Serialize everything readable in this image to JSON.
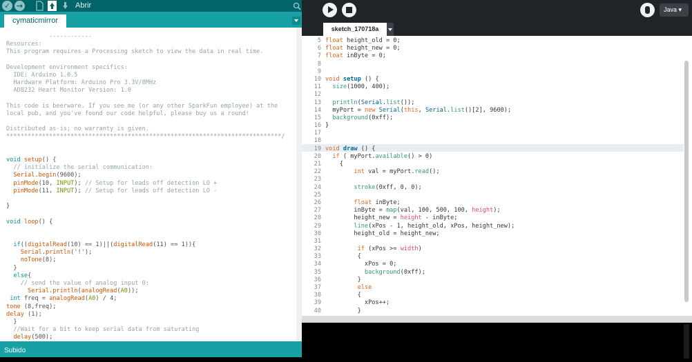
{
  "arduino": {
    "toolbar": {
      "verify_icon": "checkmark-icon",
      "upload_icon": "arrow-right-icon",
      "new_icon": "new-file-icon",
      "open_icon": "open-arrow-up-icon",
      "save_icon": "save-arrow-down-icon",
      "open_label": "Abrir",
      "serial_icon": "magnifier-icon"
    },
    "tab_label": "cymaticmirror",
    "code_lines": [
      {
        "c": "cm",
        "t": "            ------------"
      },
      {
        "c": "cm",
        "t": "Resources:"
      },
      {
        "c": "cm",
        "t": "This program requires a Processing sketch to view the data in real time."
      },
      {
        "c": "cm",
        "t": ""
      },
      {
        "c": "cm",
        "t": "Development environment specifics:"
      },
      {
        "c": "cm",
        "t": "  IDE: Arduino 1.0.5"
      },
      {
        "c": "cm",
        "t": "  Hardware Platform: Arduino Pro 3.3V/8MHz"
      },
      {
        "c": "cm",
        "t": "  AD8232 Heart Monitor Version: 1.0"
      },
      {
        "c": "cm",
        "t": ""
      },
      {
        "c": "cm",
        "t": "This code is beerware. If you see me (or any other SparkFun employee) at the"
      },
      {
        "c": "cm",
        "t": "local pub, and you've found our code helpful, please buy us a round!"
      },
      {
        "c": "cm",
        "t": ""
      },
      {
        "c": "cm",
        "t": "Distributed as-is; no warranty is given."
      },
      {
        "c": "cm",
        "t": "*****************************************************************************/"
      },
      {
        "c": "tx",
        "t": ""
      },
      {
        "c": "tx",
        "t": ""
      },
      {
        "c": "tx",
        "t": "void setup() {"
      },
      {
        "c": "tx",
        "t": "  // initialize the serial communication:"
      },
      {
        "c": "tx",
        "t": "  Serial.begin(9600);"
      },
      {
        "c": "tx",
        "t": "  pinMode(10, INPUT); // Setup for leads off detection LO +"
      },
      {
        "c": "tx",
        "t": "  pinMode(11, INPUT); // Setup for leads off detection LO -"
      },
      {
        "c": "tx",
        "t": ""
      },
      {
        "c": "tx",
        "t": "}"
      },
      {
        "c": "tx",
        "t": ""
      },
      {
        "c": "tx",
        "t": "void loop() {"
      },
      {
        "c": "tx",
        "t": ""
      },
      {
        "c": "tx",
        "t": ""
      },
      {
        "c": "tx",
        "t": "  if((digitalRead(10) == 1)||(digitalRead(11) == 1)){"
      },
      {
        "c": "tx",
        "t": "    Serial.println('!');"
      },
      {
        "c": "tx",
        "t": "    noTone(8);"
      },
      {
        "c": "tx",
        "t": "  }"
      },
      {
        "c": "tx",
        "t": "  else{"
      },
      {
        "c": "tx",
        "t": "    // send the value of analog input 0:"
      },
      {
        "c": "tx",
        "t": "      Serial.println(analogRead(A0));"
      },
      {
        "c": "tx",
        "t": " int freq = analogRead(A0) / 4;"
      },
      {
        "c": "tx",
        "t": "tone (8,freq);"
      },
      {
        "c": "tx",
        "t": "delay (1);"
      },
      {
        "c": "tx",
        "t": "  }"
      },
      {
        "c": "tx",
        "t": "  //Wait for a bit to keep serial data from saturating"
      },
      {
        "c": "tx",
        "t": "  delay(500);"
      },
      {
        "c": "tx",
        "t": "}"
      }
    ],
    "status_text": "Subido"
  },
  "processing": {
    "toolbar": {
      "run_icon": "play-icon",
      "stop_icon": "stop-icon",
      "debug_icon": "debugger-butterfly-icon",
      "mode_label": "Java ▾"
    },
    "tab_label": "sketch_170718a",
    "code_lines": [
      {
        "n": "5",
        "t": "float height_old = 0;"
      },
      {
        "n": "6",
        "t": "float height_new = 0;"
      },
      {
        "n": "7",
        "t": "float inByte = 0;"
      },
      {
        "n": "8",
        "t": ""
      },
      {
        "n": "9",
        "t": ""
      },
      {
        "n": "10",
        "t": "void setup () {"
      },
      {
        "n": "11",
        "t": "  size(1000, 400);"
      },
      {
        "n": "12",
        "t": ""
      },
      {
        "n": "13",
        "t": "  println(Serial.list());"
      },
      {
        "n": "14",
        "t": "  myPort = new Serial(this, Serial.list()[2], 9600);"
      },
      {
        "n": "15",
        "t": "  background(0xff);"
      },
      {
        "n": "16",
        "t": "}"
      },
      {
        "n": "17",
        "t": ""
      },
      {
        "n": "18",
        "t": ""
      },
      {
        "n": "19",
        "t": "void draw () {"
      },
      {
        "n": "20",
        "t": "  if ( myPort.available() > 0)"
      },
      {
        "n": "21",
        "t": "    {"
      },
      {
        "n": "22",
        "t": "        int val = myPort.read();"
      },
      {
        "n": "23",
        "t": ""
      },
      {
        "n": "24",
        "t": "        stroke(0xff, 0, 0);"
      },
      {
        "n": "25",
        "t": ""
      },
      {
        "n": "26",
        "t": "        float inByte;"
      },
      {
        "n": "27",
        "t": "        inByte = map(val, 100, 500, 100, height);"
      },
      {
        "n": "28",
        "t": "        height_new = height - inByte;"
      },
      {
        "n": "29",
        "t": "        line(xPos - 1, height_old, xPos, height_new);"
      },
      {
        "n": "30",
        "t": "        height_old = height_new;"
      },
      {
        "n": "31",
        "t": ""
      },
      {
        "n": "32",
        "t": "         if (xPos >= width)"
      },
      {
        "n": "33",
        "t": "         {"
      },
      {
        "n": "34",
        "t": "           xPos = 0;"
      },
      {
        "n": "35",
        "t": "           background(0xff);"
      },
      {
        "n": "36",
        "t": "         }"
      },
      {
        "n": "37",
        "t": "         else"
      },
      {
        "n": "38",
        "t": "         {"
      },
      {
        "n": "39",
        "t": "           xPos++;"
      },
      {
        "n": "40",
        "t": "         }"
      }
    ]
  },
  "colors": {
    "arduino_teal": "#006468",
    "arduino_tab_bar": "#17a1a5",
    "processing_dark": "#1e2428"
  }
}
